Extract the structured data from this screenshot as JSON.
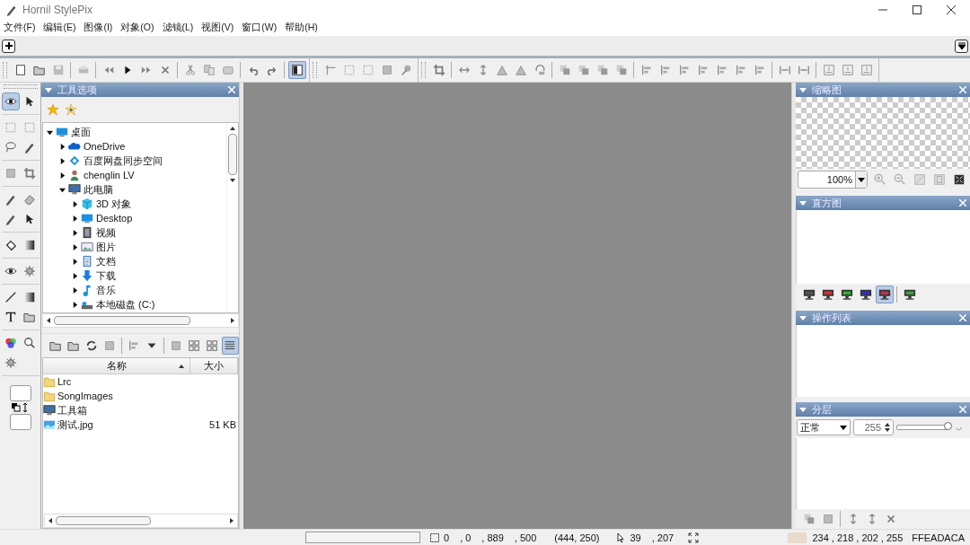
{
  "window": {
    "title": "Hornil StylePix"
  },
  "menu": [
    "文件(F)",
    "编辑(E)",
    "图像(I)",
    "对象(O)",
    "滤镜(L)",
    "视图(V)",
    "窗口(W)",
    "帮助(H)"
  ],
  "toolbar": [
    [
      [
        {
          "kind": "new",
          "selected": false
        },
        {
          "kind": "open",
          "selected": false
        },
        {
          "kind": "save",
          "selected": false
        }
      ],
      [
        {
          "kind": "print",
          "selected": false
        }
      ],
      [
        {
          "kind": "first",
          "selected": false
        },
        {
          "kind": "play",
          "selected": false
        },
        {
          "kind": "last",
          "selected": false
        },
        {
          "kind": "cross",
          "selected": false
        }
      ],
      [
        {
          "kind": "cut",
          "selected": false
        },
        {
          "kind": "copy",
          "selected": false
        },
        {
          "kind": "paste",
          "selected": false
        }
      ],
      [
        {
          "kind": "undo",
          "selected": false
        },
        {
          "kind": "redo",
          "selected": false
        }
      ],
      [
        {
          "kind": "panel",
          "selected": true
        }
      ]
    ],
    [
      [
        {
          "kind": "ruler",
          "selected": false
        },
        {
          "kind": "grid",
          "selected": false
        },
        {
          "kind": "grid",
          "selected": false
        },
        {
          "kind": "square",
          "selected": false
        },
        {
          "kind": "pin",
          "selected": false
        }
      ]
    ],
    [
      [
        {
          "kind": "crop",
          "selected": false
        }
      ],
      [
        {
          "kind": "harrow",
          "selected": false
        },
        {
          "kind": "varrow",
          "selected": false
        },
        {
          "kind": "triangle",
          "selected": false
        },
        {
          "kind": "triangle",
          "selected": false
        },
        {
          "kind": "rotate",
          "selected": false
        }
      ],
      [
        {
          "kind": "stack",
          "selected": false
        },
        {
          "kind": "stack",
          "selected": false
        },
        {
          "kind": "stack",
          "selected": false
        },
        {
          "kind": "stack",
          "selected": false
        }
      ],
      [
        {
          "kind": "align",
          "selected": false
        },
        {
          "kind": "align",
          "selected": false
        },
        {
          "kind": "align",
          "selected": false
        },
        {
          "kind": "align",
          "selected": false
        },
        {
          "kind": "align",
          "selected": false
        },
        {
          "kind": "align",
          "selected": false
        },
        {
          "kind": "align",
          "selected": false
        }
      ],
      [
        {
          "kind": "distribute",
          "selected": false
        },
        {
          "kind": "distribute",
          "selected": false
        }
      ],
      [
        {
          "kind": "resize",
          "selected": false
        },
        {
          "kind": "resize",
          "selected": false
        },
        {
          "kind": "resize",
          "selected": false
        }
      ]
    ]
  ],
  "tools": [
    [
      {
        "kind": "eye",
        "selected": true
      },
      {
        "kind": "pointer",
        "selected": false
      }
    ],
    [
      {
        "kind": "grid",
        "selected": false
      },
      {
        "kind": "grid",
        "selected": false
      },
      {
        "kind": "lasso",
        "selected": false
      },
      {
        "kind": "pen",
        "selected": false
      }
    ],
    [
      {
        "kind": "square",
        "selected": false
      },
      {
        "kind": "crop",
        "selected": false
      }
    ],
    [
      {
        "kind": "pen",
        "selected": false
      },
      {
        "kind": "eraser",
        "selected": false
      },
      {
        "kind": "pen",
        "selected": false
      },
      {
        "kind": "pointer",
        "selected": false
      }
    ],
    [
      {
        "kind": "bucket",
        "selected": false
      },
      {
        "kind": "gradient",
        "selected": false
      }
    ],
    [
      {
        "kind": "eye",
        "selected": false
      },
      {
        "kind": "sun",
        "selected": false
      }
    ],
    [
      {
        "kind": "line",
        "selected": false
      },
      {
        "kind": "gradient",
        "selected": false
      },
      {
        "kind": "text",
        "selected": false
      },
      {
        "kind": "open",
        "selected": false
      }
    ],
    [
      {
        "kind": "wheel",
        "selected": false
      },
      {
        "kind": "magnifier",
        "selected": false
      },
      {
        "kind": "sun",
        "selected": false
      }
    ]
  ],
  "tool_options": {
    "title": "工具选项",
    "tree": [
      {
        "label": "桌面",
        "kind": "desktop",
        "expanded": true,
        "children": [
          {
            "label": "OneDrive",
            "kind": "cloud",
            "expanded": false
          },
          {
            "label": "百度网盘同步空间",
            "kind": "diamond",
            "expanded": false
          },
          {
            "label": "chenglin LV",
            "kind": "user",
            "expanded": false
          },
          {
            "label": "此电脑",
            "kind": "computer",
            "expanded": true,
            "children": [
              {
                "label": "3D 对象",
                "kind": "cube",
                "expanded": false
              },
              {
                "label": "Desktop",
                "kind": "desktop",
                "expanded": false
              },
              {
                "label": "视频",
                "kind": "film",
                "expanded": false
              },
              {
                "label": "图片",
                "kind": "picture",
                "expanded": false
              },
              {
                "label": "文档",
                "kind": "document",
                "expanded": false
              },
              {
                "label": "下载",
                "kind": "download",
                "expanded": false
              },
              {
                "label": "音乐",
                "kind": "music",
                "expanded": false
              },
              {
                "label": "本地磁盘 (C:)",
                "kind": "drive",
                "expanded": false
              }
            ]
          }
        ]
      }
    ],
    "file_tools": [
      [
        {
          "kind": "open",
          "selected": false
        },
        {
          "kind": "open",
          "selected": false
        },
        {
          "kind": "refresh",
          "selected": false
        },
        {
          "kind": "square",
          "selected": false
        }
      ],
      [
        {
          "kind": "align",
          "selected": false
        },
        {
          "kind": "dropdown",
          "selected": false
        }
      ],
      [
        {
          "kind": "square",
          "selected": false
        },
        {
          "kind": "grid4",
          "selected": false
        },
        {
          "kind": "grid4",
          "selected": false
        },
        {
          "kind": "details",
          "selected": true
        }
      ]
    ],
    "columns": [
      {
        "label": "名称",
        "sorted": true
      },
      {
        "label": "大小",
        "sorted": false
      }
    ],
    "files": [
      {
        "name": "Lrc",
        "kind": "folder"
      },
      {
        "name": "SongImages",
        "kind": "folder"
      },
      {
        "name": "工具箱",
        "kind": "computer"
      },
      {
        "name": "测试.jpg",
        "size": "51 KB",
        "kind": "image"
      }
    ]
  },
  "thumbnail": {
    "title": "缩略图",
    "zoom": "100%"
  },
  "histogram": {
    "title": "直方图",
    "channels": [
      {
        "color": "#555555",
        "selected": false
      },
      {
        "color": "#d83030",
        "selected": false
      },
      {
        "color": "#30b030",
        "selected": false
      },
      {
        "color": "#3030c0",
        "selected": false
      },
      {
        "color": "#c03050",
        "selected": true
      },
      {
        "color": "#40a040",
        "selected": false
      }
    ]
  },
  "history": {
    "title": "操作列表"
  },
  "layers": {
    "title": "分层",
    "blend": "正常",
    "opacity": "255",
    "level": 1
  },
  "status_bar": {
    "progress": {
      "level": 0
    },
    "selection": [
      "0",
      ", 0",
      ", 889",
      ", 500"
    ],
    "center": "(444, 250)",
    "cursor": [
      "39",
      ", 207"
    ],
    "rgba": "234 , 218 , 202 , 255",
    "hex": "FFEADACA"
  }
}
